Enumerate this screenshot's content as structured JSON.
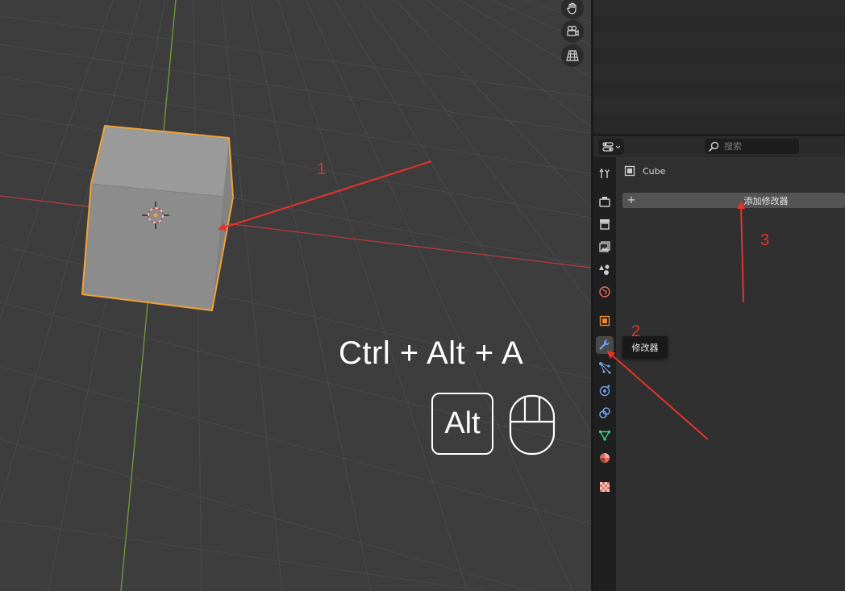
{
  "viewport": {
    "gizmos": [
      {
        "name": "hand-pan-icon",
        "y": -4
      },
      {
        "name": "camera-view-icon",
        "y": 25
      },
      {
        "name": "perspective-grid-icon",
        "y": 55
      }
    ],
    "shortcut_text": "Ctrl + Alt + A",
    "alt_key_label": "Alt",
    "icons": [
      "3d-cursor-icon",
      "origin-dot-icon",
      "mouse-icon"
    ]
  },
  "properties": {
    "search_placeholder": "搜索",
    "object_name": "Cube",
    "add_modifier_label": "添加修改器",
    "add_modifier_plus": "+",
    "tabs": [
      {
        "name": "tool-icon",
        "color": "#cfcfcf"
      },
      {
        "name": "render-icon",
        "color": "#cfcfcf"
      },
      {
        "name": "output-icon",
        "color": "#cfcfcf"
      },
      {
        "name": "view-layer-icon",
        "color": "#cfcfcf"
      },
      {
        "name": "scene-icon",
        "color": "#cfcfcf"
      },
      {
        "name": "world-icon",
        "color": "#e06a5a"
      },
      {
        "name": "object-icon",
        "color": "#e8893a"
      },
      {
        "name": "modifier-wrench-icon",
        "color": "#6f9fe8",
        "active": true
      },
      {
        "name": "particles-icon",
        "color": "#6f9fe8"
      },
      {
        "name": "physics-icon",
        "color": "#6f9fe8"
      },
      {
        "name": "constraints-icon",
        "color": "#6f9fe8"
      },
      {
        "name": "data-icon",
        "color": "#3ecf8e"
      },
      {
        "name": "material-icon",
        "color": "#e06a5a"
      },
      {
        "name": "texture-icon",
        "color": "#e06a5a"
      }
    ]
  },
  "tooltip": {
    "text": "修改器"
  },
  "annotations": {
    "step1": "1",
    "step2": "2",
    "step3": "3",
    "color": "#e8322c"
  },
  "colors": {
    "selection_outline": "#f0a23a",
    "x_axis": "#b43c3c",
    "y_axis": "#6ea03a",
    "active_tab_icon": "#6f9fe8"
  }
}
